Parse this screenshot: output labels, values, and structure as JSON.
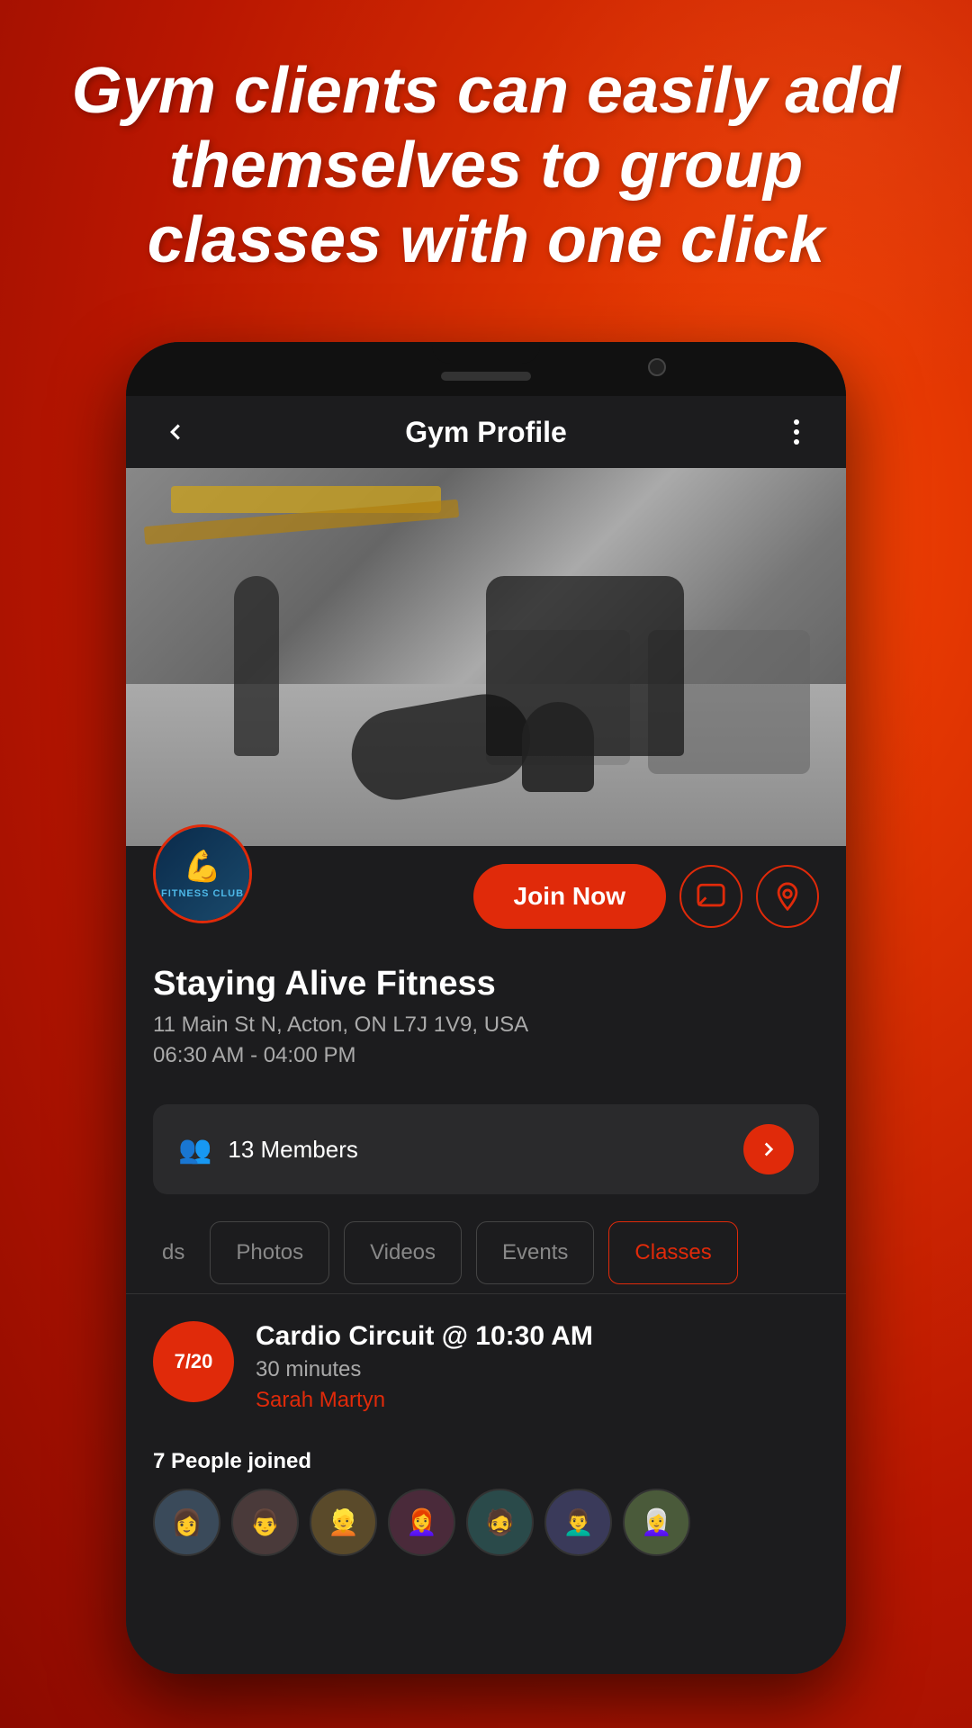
{
  "background": {
    "color": "#e02a0a"
  },
  "headline": {
    "text": "Gym clients can easily add themselves to group classes with one click"
  },
  "appbar": {
    "title": "Gym Profile",
    "back_label": "back",
    "more_label": "more options"
  },
  "gym": {
    "name": "Staying Alive Fitness",
    "address": "11 Main St N, Acton, ON L7J 1V9, USA",
    "hours": "06:30 AM - 04:00 PM",
    "members_count": "13 Members",
    "logo_label": "FITNESS CLUB"
  },
  "actions": {
    "join_now": "Join Now",
    "message_icon": "message",
    "location_icon": "location"
  },
  "tabs": {
    "partial": "ds",
    "photos": "Photos",
    "videos": "Videos",
    "events": "Events",
    "classes": "Classes"
  },
  "class_card": {
    "badge": "7/20",
    "title": "Cardio Circuit @ 10:30 AM",
    "duration": "30 minutes",
    "trainer": "Sarah Martyn",
    "people_joined_label": "7 People joined"
  },
  "avatars": [
    {
      "emoji": "👩"
    },
    {
      "emoji": "👨"
    },
    {
      "emoji": "👱"
    },
    {
      "emoji": "👩‍🦰"
    },
    {
      "emoji": "🧔"
    },
    {
      "emoji": "👨‍🦱"
    },
    {
      "emoji": "👩‍🦳"
    }
  ]
}
